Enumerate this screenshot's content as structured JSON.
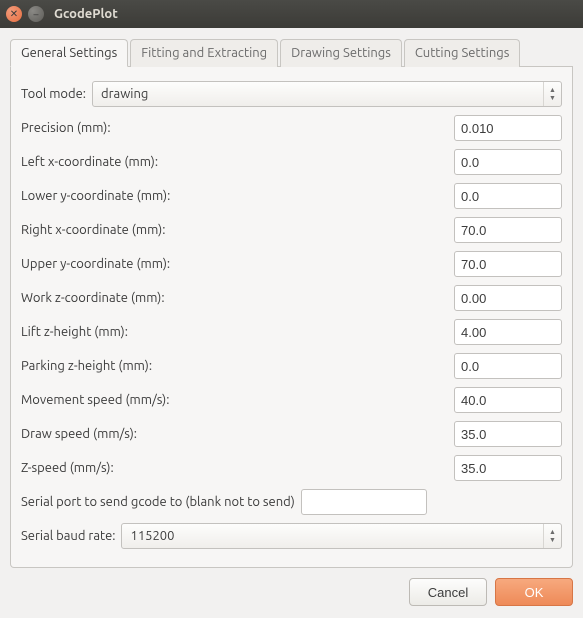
{
  "window": {
    "title": "GcodePlot"
  },
  "tabs": {
    "general": "General Settings",
    "fitting": "Fitting and Extracting",
    "drawing": "Drawing Settings",
    "cutting": "Cutting Settings"
  },
  "fields": {
    "tool_mode": {
      "label": "Tool mode:",
      "value": "drawing"
    },
    "precision": {
      "label": "Precision (mm):",
      "value": "0.010"
    },
    "left_x": {
      "label": "Left x-coordinate (mm):",
      "value": "0.0"
    },
    "lower_y": {
      "label": "Lower y-coordinate (mm):",
      "value": "0.0"
    },
    "right_x": {
      "label": "Right x-coordinate (mm):",
      "value": "70.0"
    },
    "upper_y": {
      "label": "Upper y-coordinate (mm):",
      "value": "70.0"
    },
    "work_z": {
      "label": "Work z-coordinate (mm):",
      "value": "0.00"
    },
    "lift_z": {
      "label": "Lift z-height (mm):",
      "value": "4.00"
    },
    "park_z": {
      "label": "Parking z-height (mm):",
      "value": "0.0"
    },
    "move_speed": {
      "label": "Movement speed (mm/s):",
      "value": "40.0"
    },
    "draw_speed": {
      "label": "Draw speed (mm/s):",
      "value": "35.0"
    },
    "z_speed": {
      "label": "Z-speed (mm/s):",
      "value": "35.0"
    },
    "serial_port": {
      "label": "Serial port to send gcode to (blank not to send)",
      "value": ""
    },
    "baud_rate": {
      "label": "Serial baud rate:",
      "value": "115200"
    }
  },
  "buttons": {
    "cancel": "Cancel",
    "ok": "OK"
  }
}
